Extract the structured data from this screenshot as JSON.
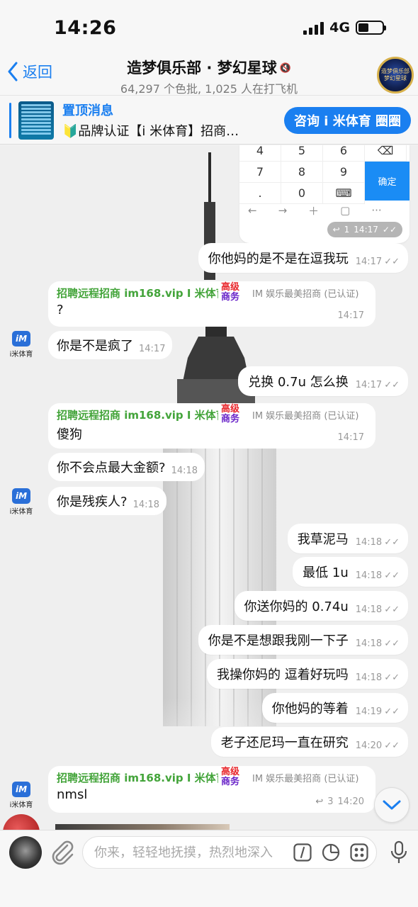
{
  "status": {
    "time": "14:26",
    "network": "4G"
  },
  "header": {
    "back_label": "返回",
    "title": "造梦俱乐部 · 梦幻星球",
    "subtitle": "64,297 个色批, 1,025 人在打飞机",
    "avatar_text": "造梦俱乐部 梦幻星球"
  },
  "pinned": {
    "title": "置顶消息",
    "text": "🔰品牌认证【i 米体育】招商…",
    "button_label": "咨询 i 米体育 圈圈"
  },
  "keypad": {
    "rows": [
      [
        "4",
        "5",
        "6",
        "⌫"
      ],
      [
        "7",
        "8",
        "9",
        ""
      ],
      [
        ".",
        "0",
        "⌨",
        ""
      ]
    ],
    "ok_label": "确定",
    "reply_count": "1",
    "time": "14:17"
  },
  "messages": {
    "m1": {
      "text": "你他妈的是不是在逗我玩",
      "time": "14:17"
    },
    "c1": {
      "sender": "招聘远程招商 im168.vip I 米体育...",
      "badge_top": "高级",
      "badge_bottom": "商务",
      "role": "IM 娱乐最美招商 (已认证)",
      "text": "?",
      "time": "14:17"
    },
    "i1": {
      "text": "你是不是疯了",
      "time": "14:17"
    },
    "m2": {
      "text": "兑换 0.7u 怎么换",
      "time": "14:17"
    },
    "c2": {
      "sender": "招聘远程招商 im168.vip I 米体育...",
      "badge_top": "高级",
      "badge_bottom": "商务",
      "role": "IM 娱乐最美招商 (已认证)",
      "text": "傻狗",
      "time": "14:17"
    },
    "i2": {
      "text": "你不会点最大金额?",
      "time": "14:18"
    },
    "i3": {
      "text": "你是残疾人?",
      "time": "14:18"
    },
    "m3": {
      "text": "我草泥马",
      "time": "14:18"
    },
    "m4": {
      "text": "最低 1u",
      "time": "14:18"
    },
    "m5": {
      "text": "你送你妈的 0.74u",
      "time": "14:18"
    },
    "m6": {
      "text": "你是不是想跟我刚一下子",
      "time": "14:18"
    },
    "m7": {
      "text": "我操你妈的 逗着好玩吗",
      "time": "14:18"
    },
    "m8": {
      "text": "你他妈的等着",
      "time": "14:19"
    },
    "m9": {
      "text": "老子还尼玛一直在研究",
      "time": "14:20"
    },
    "c3": {
      "sender": "招聘远程招商 im168.vip I 米体育...",
      "badge_top": "高级",
      "badge_bottom": "商务",
      "role": "IM 娱乐最美招商 (已认证)",
      "text": "nmsl",
      "reply_count": "3",
      "time": "14:20"
    }
  },
  "im_avatar": {
    "logo": "iM",
    "label": "i米体育"
  },
  "input": {
    "placeholder": "你来，轻轻地抚摸，热烈地深入"
  },
  "colors": {
    "accent": "#1a7ff0",
    "sender_green": "#43a43a",
    "badge_red": "#e8262b",
    "badge_purple": "#6a25c9"
  }
}
